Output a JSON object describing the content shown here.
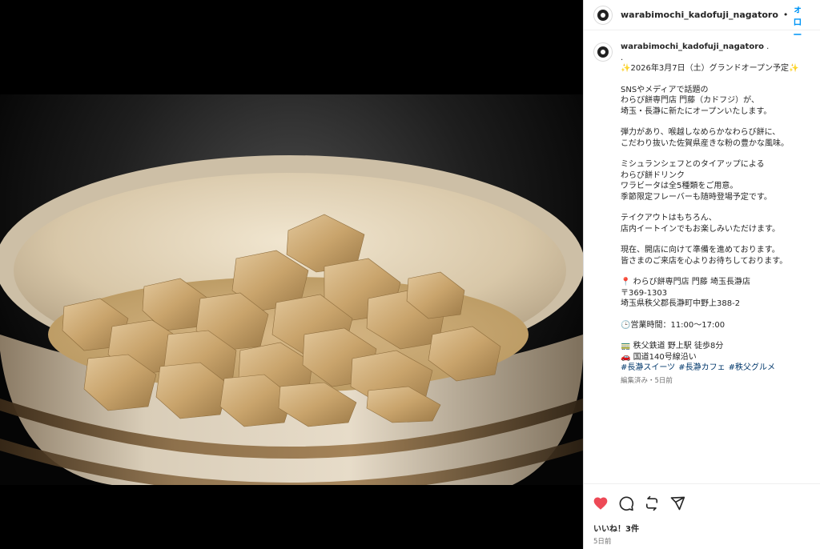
{
  "post": {
    "username": "warabimochi_kadofuji_nagatoro",
    "separator": "•",
    "follow_label": "フォロー",
    "caption_username_suffix": " .",
    "caption_lines": [
      ".",
      "✨2026年3月7日（土）グランドオープン予定✨",
      "",
      "SNSやメディアで話題の",
      "わらび餅専門店 門藤（カドフジ）が、",
      "埼玉・長瀞に新たにオープンいたします。",
      "",
      "弾力があり、喉越しなめらかなわらび餅に、",
      "こだわり抜いた佐賀県産きな粉の豊かな風味。",
      "",
      "ミシュランシェフとのタイアップによる",
      "わらび餅ドリンク",
      "ワラビータは全5種類をご用意。",
      "季節限定フレーバーも随時登場予定です。",
      "",
      "テイクアウトはもちろん、",
      "店内イートインでもお楽しみいただけます。",
      "",
      "現在、開店に向けて準備を進めております。",
      "皆さまのご来店を心よりお待ちしております。",
      "",
      "📍 わらび餅専門店 門藤 埼玉長瀞店",
      "〒369-1303",
      "埼玉県秩父郡長瀞町中野上388-2",
      "",
      "🕒営業時間：11:00〜17:00",
      "",
      "🚃 秩父鉄道 野上駅 徒歩8分",
      "🚗 国道140号線沿い"
    ],
    "hashtags": [
      "#長瀞スイーツ",
      "#長瀞カフェ",
      "#秩父グルメ"
    ],
    "edited_meta": "編集済み・5日前",
    "likes_text": "いいね！3件",
    "time_ago": "5日前"
  },
  "icons": {
    "like": "heart-icon",
    "comment": "comment-icon",
    "repost": "repost-icon",
    "share": "share-icon"
  },
  "colors": {
    "like_red": "#ed4956",
    "link_blue": "#0095f6",
    "hashtag": "#00376b",
    "kinako": "#c9a46c"
  }
}
